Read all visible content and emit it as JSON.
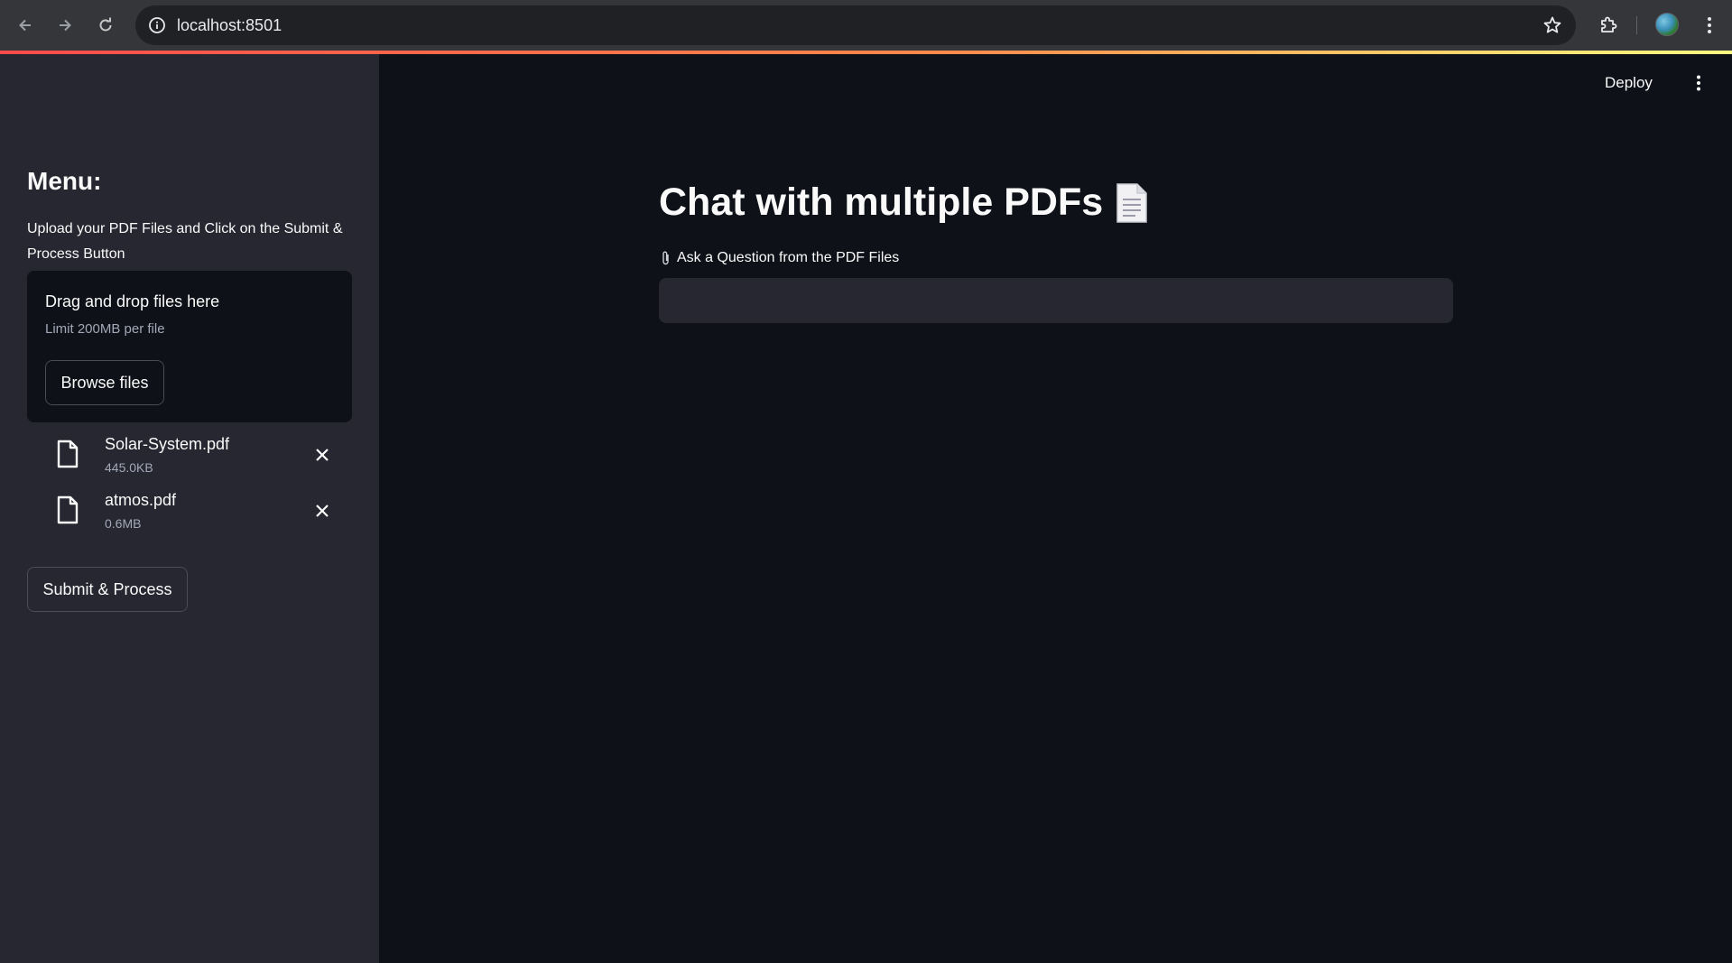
{
  "browser": {
    "url": "localhost:8501"
  },
  "sidebar": {
    "menu_title": "Menu:",
    "instructions": "Upload your PDF Files and Click on the Submit & Process Button",
    "uploader": {
      "dropzone_title": "Drag and drop files here",
      "limit_text": "Limit 200MB per file",
      "browse_label": "Browse files"
    },
    "files": [
      {
        "name": "Solar-System.pdf",
        "size": "445.0KB"
      },
      {
        "name": "atmos.pdf",
        "size": "0.6MB"
      }
    ],
    "submit_label": "Submit & Process"
  },
  "header": {
    "deploy_label": "Deploy"
  },
  "main": {
    "title": "Chat with multiple PDFs",
    "question_label": "Ask a Question from the PDF Files",
    "question_value": ""
  },
  "colors": {
    "background": "#0e1117",
    "sidebar": "#262730",
    "accent_gradient_start": "#ff4b4b",
    "accent_gradient_end": "#fffd80",
    "text": "#fafafa"
  }
}
